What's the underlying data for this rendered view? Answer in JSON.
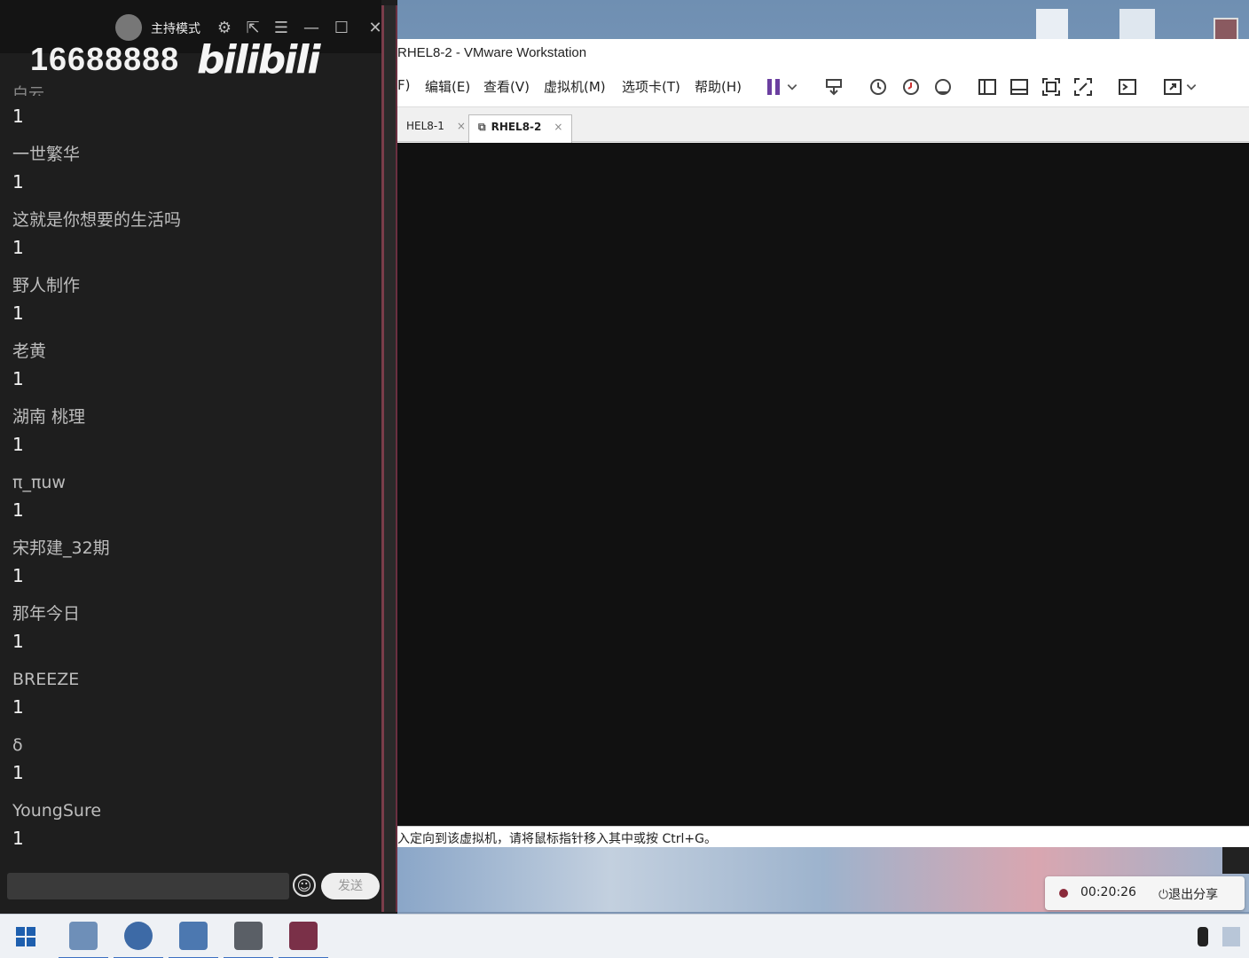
{
  "vmware": {
    "title": "RHEL8-2 - VMware Workstation",
    "menu": [
      "F)",
      "编辑(E)",
      "查看(V)",
      "虚拟机(M)",
      "选项卡(T)",
      "帮助(H)"
    ],
    "tabs": [
      {
        "label": "HEL8-1",
        "close": "×"
      },
      {
        "label": "RHEL8-2",
        "close": "×"
      }
    ],
    "status_text": "入定向到该虚拟机，请将鼠标指针移入其中或按 Ctrl+G。"
  },
  "share": {
    "timer": "00:20:26",
    "exit_label": "退出分享"
  },
  "chat": {
    "host_mode": "主持模式",
    "room_id": "16688888",
    "logo_text": "bilibili",
    "partial_top_name": "白云",
    "messages": [
      {
        "name": "一世繁华",
        "text": "1"
      },
      {
        "name": "这就是你想要的生活吗",
        "text": "1"
      },
      {
        "name": "野人制作",
        "text": "1"
      },
      {
        "name": "老黄",
        "text": "1"
      },
      {
        "name": "湖南 桃理",
        "text": "1"
      },
      {
        "name": "π_πuw",
        "text": "1"
      },
      {
        "name": "宋邦建_32期",
        "text": "1"
      },
      {
        "name": "那年今日",
        "text": "1"
      },
      {
        "name": "BREEZE",
        "text": "1"
      },
      {
        "name": "δ",
        "text": "1"
      },
      {
        "name": "YoungSure",
        "text": "1"
      }
    ],
    "first_text": "1",
    "send_label": "发送"
  },
  "icons": [
    "settings-icon",
    "popout-icon",
    "menu-icon",
    "minimize-icon",
    "maximize-icon",
    "close-icon",
    "pause-icon",
    "snapshot-icon",
    "terminal-icon",
    "fullscreen-icon",
    "emoji-icon"
  ],
  "colors": {
    "chat_bg": "#1e1e1e",
    "vm_screen": "#111111",
    "accent_taskbar": "#3c6fc2"
  }
}
